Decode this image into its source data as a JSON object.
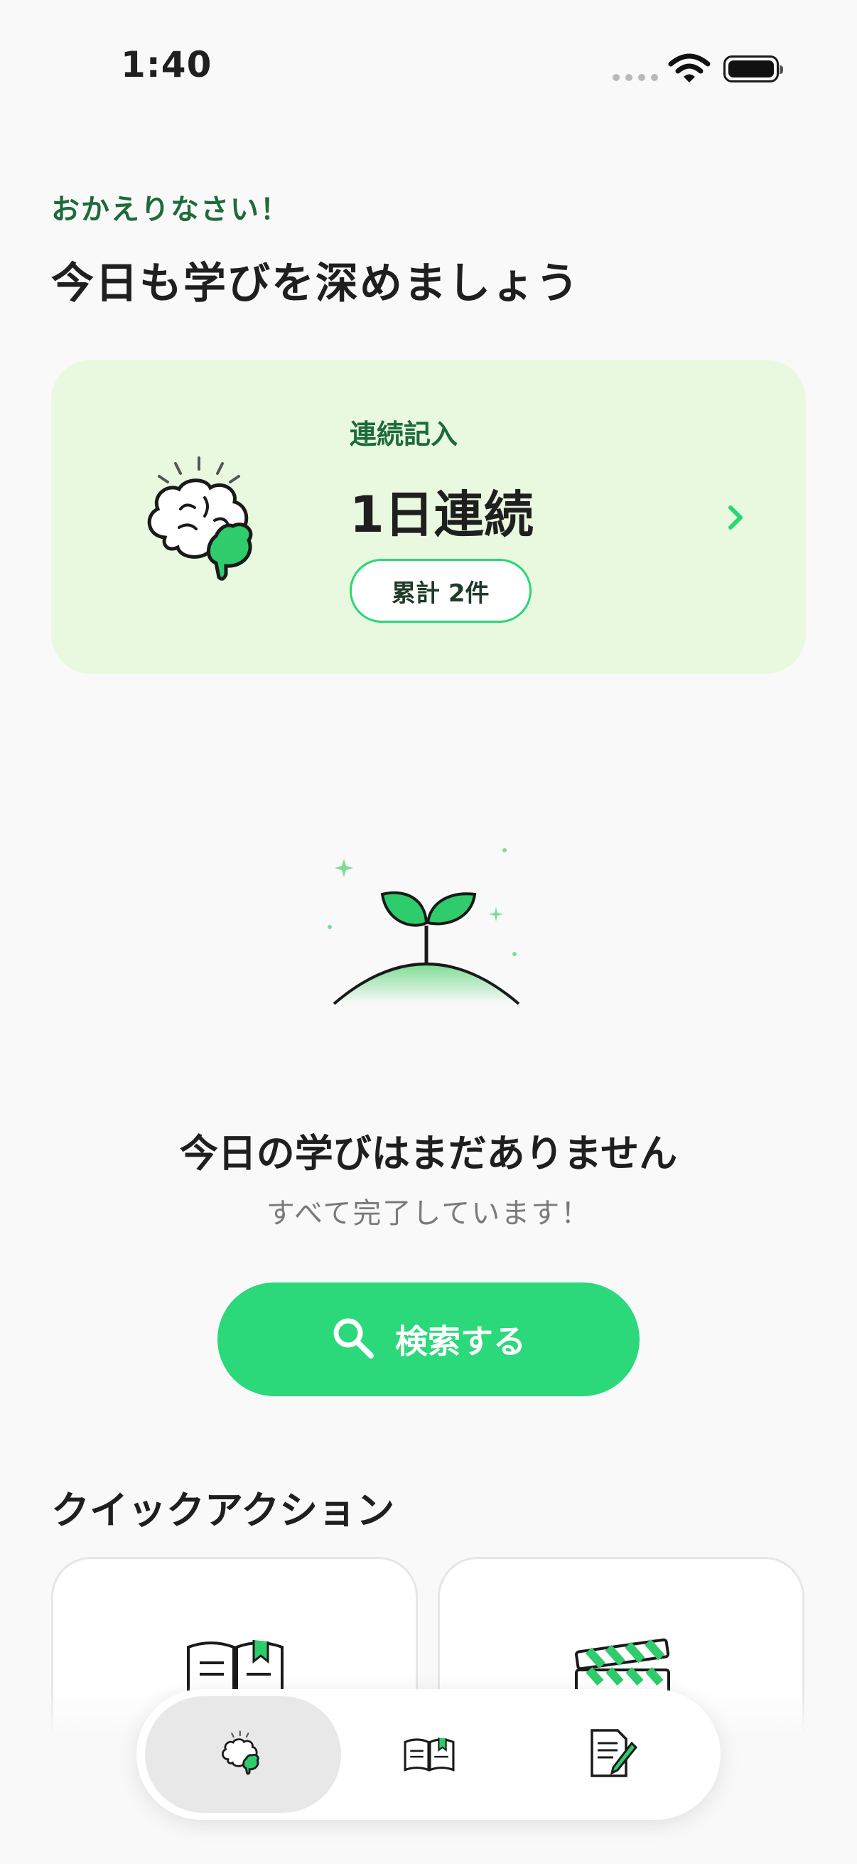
{
  "status_bar": {
    "time": "1:40"
  },
  "header": {
    "greeting": "おかえりなさい！",
    "headline": "今日も学びを深めましょう"
  },
  "streak_card": {
    "label": "連続記入",
    "value": "1日連続",
    "badge": "累計 2件",
    "icon": "brain-icon"
  },
  "empty_state": {
    "illustration": "sprout-icon",
    "title": "今日の学びはまだありません",
    "subtitle": "すべて完了しています！"
  },
  "search_button": {
    "label": "検索する",
    "icon": "search-icon"
  },
  "quick_actions": {
    "title": "クイックアクション",
    "items": [
      {
        "icon": "book-icon"
      },
      {
        "icon": "clapperboard-icon"
      }
    ]
  },
  "tab_bar": {
    "tabs": [
      {
        "icon": "brain-icon",
        "active": true
      },
      {
        "icon": "book-icon",
        "active": false
      },
      {
        "icon": "note-pencil-icon",
        "active": false
      }
    ]
  },
  "colors": {
    "accent": "#2bd87a",
    "accent_dark": "#1d6b3a",
    "card_bg": "#e8f9df",
    "background": "#f9f9f9"
  }
}
